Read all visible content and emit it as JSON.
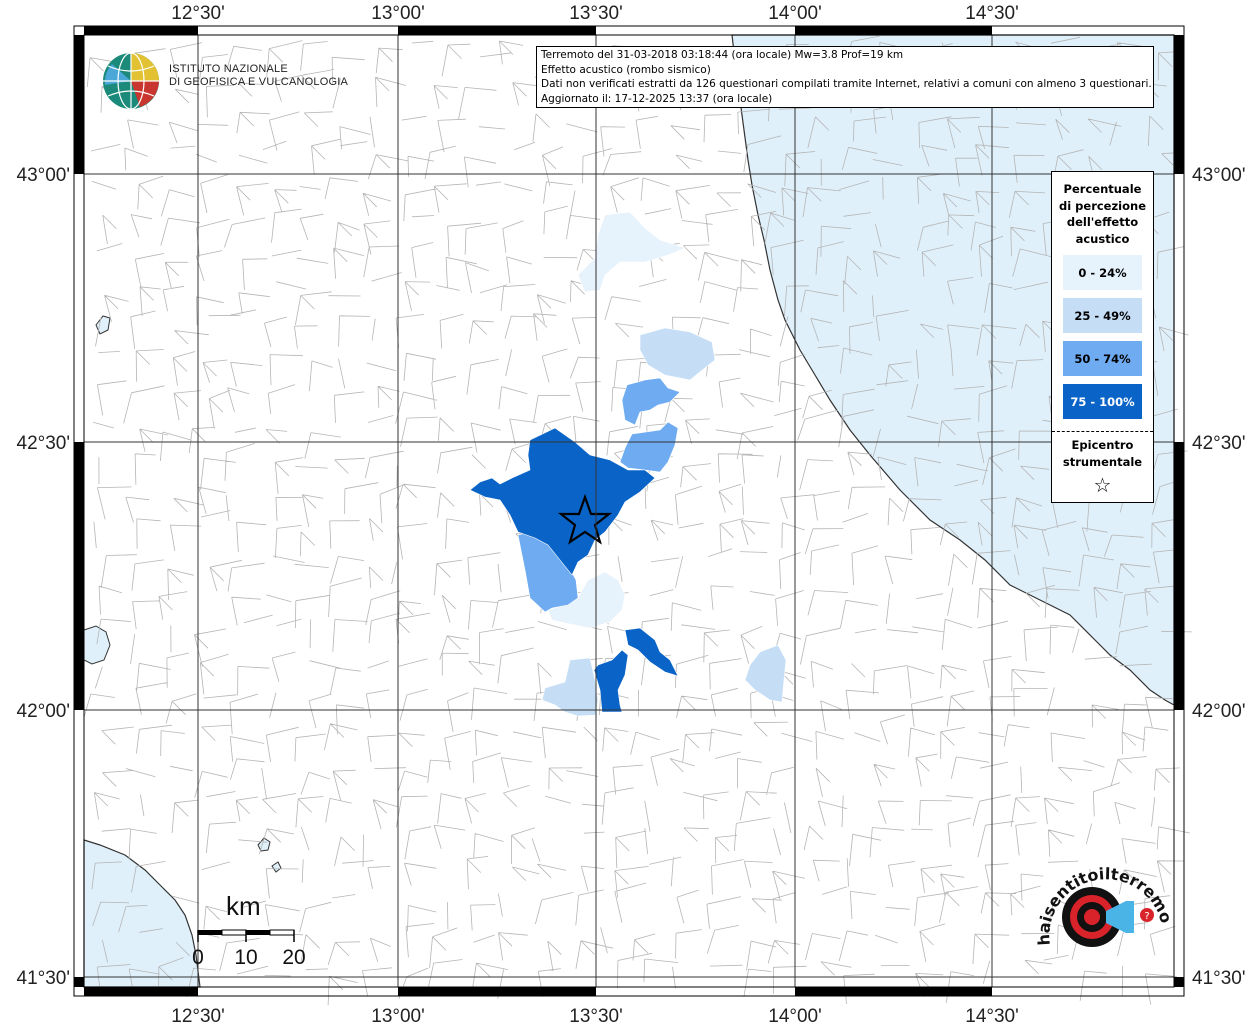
{
  "map": {
    "x_ticks": [
      "12°30'",
      "13°00'",
      "13°30'",
      "14°00'",
      "14°30'"
    ],
    "y_ticks": [
      "43°00'",
      "42°30'",
      "42°00'",
      "41°30'"
    ],
    "sea_color": "#dff0fb",
    "epicenter_label": "Epicentro strumentale"
  },
  "info": {
    "line1": "Terremoto del 31-03-2018 03:18:44 (ora locale) Mw=3.8 Prof=19 km",
    "line2": "Effetto acustico (rombo sismico)",
    "line3": "Dati non verificati estratti da 126 questionari compilati tramite Internet, relativi a comuni con almeno 3 questionari.",
    "line4": "Aggiornato il: 17-12-2025 13:37 (ora locale)"
  },
  "legend": {
    "title_lines": [
      "Percentuale",
      "di percezione",
      "dell'effetto",
      "acustico"
    ],
    "classes": [
      {
        "label": "0 - 24%",
        "color": "#e6f2fc"
      },
      {
        "label": "25 - 49%",
        "color": "#c5def6"
      },
      {
        "label": "50 - 74%",
        "color": "#6eabf0"
      },
      {
        "label": "75 - 100%",
        "color": "#0a64c8"
      }
    ],
    "epicenter_lines": [
      "Epicentro",
      "strumentale"
    ],
    "epicenter_symbol": "☆"
  },
  "scale_bar": {
    "unit": "km",
    "labels": [
      "0",
      "10",
      "20"
    ]
  },
  "logos": {
    "ingv_line1": "ISTITUTO NAZIONALE",
    "ingv_line2": "DI GEOFISICA E VULCANOLOGIA",
    "hst_text": "haisentitoilterremoto.it"
  }
}
